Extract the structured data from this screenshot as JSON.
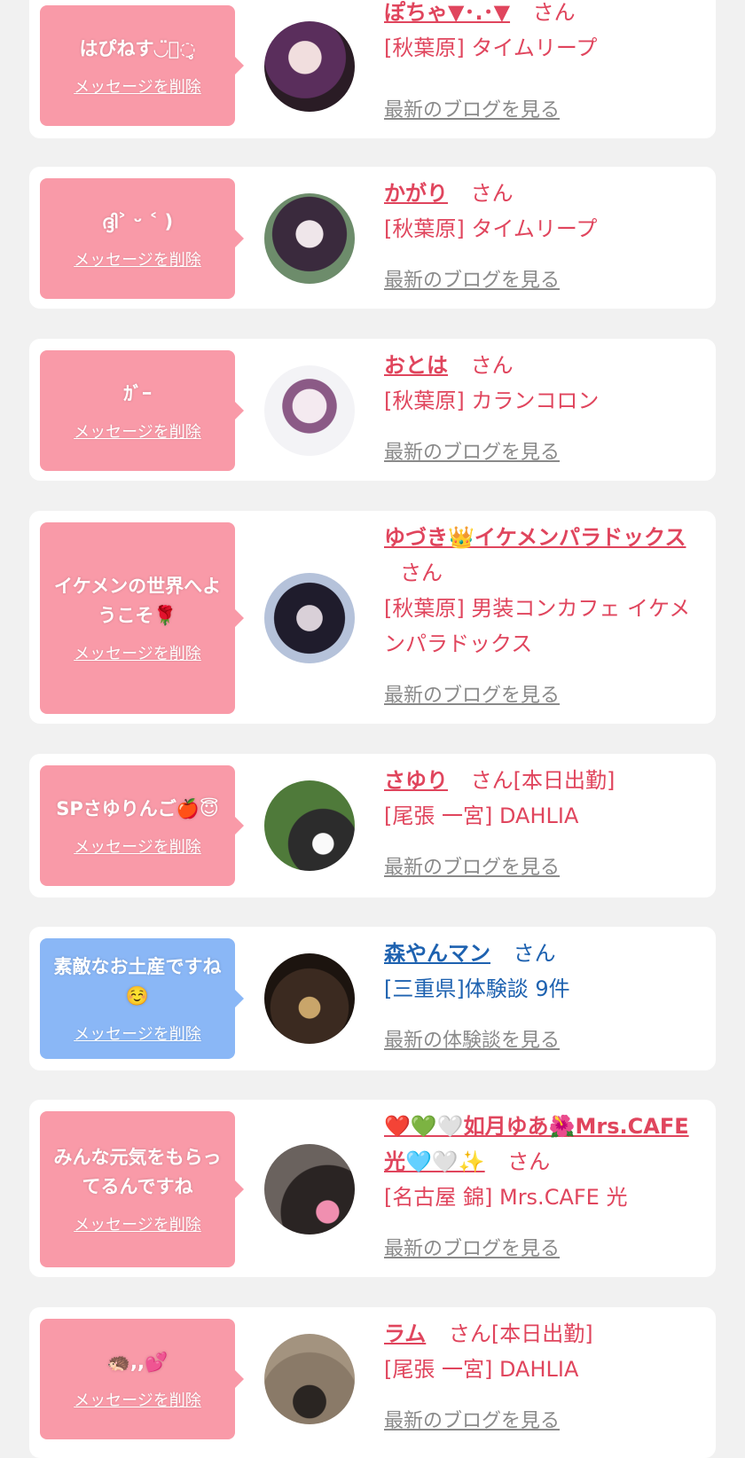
{
  "cards": [
    {
      "message": "はぴねす◡̈⃝︎◌̥",
      "delete_label": "メッセージを削除",
      "name": "ぽちゃ▼･.･▼",
      "san": "さん",
      "shop": "[秋葉原] タイムリープ",
      "blog": "最新のブログを見る",
      "accent": "#e0455d",
      "bubble_color": "#f99aa8"
    },
    {
      "message": "ദ്ദി˃ ᵕ ˂ )",
      "delete_label": "メッセージを削除",
      "name": "かがり",
      "san": "さん",
      "shop": "[秋葉原] タイムリープ",
      "blog": "最新のブログを見る"
    },
    {
      "message": "ｶﾞｰ",
      "delete_label": "メッセージを削除",
      "name": "おとは",
      "san": "さん",
      "shop": "[秋葉原] カランコロン",
      "blog": "最新のブログを見る"
    },
    {
      "message": "イケメンの世界へようこそ🌹",
      "delete_label": "メッセージを削除",
      "name": "ゆづき👑イケメンパラドックス",
      "san": "さん",
      "shop": "[秋葉原] 男装コンカフェ イケメンパラドックス",
      "blog": "最新のブログを見る"
    },
    {
      "message": "SPさゆりんご🍎😇",
      "delete_label": "メッセージを削除",
      "name": "さゆり",
      "san": "さん[本日出勤]",
      "shop": "[尾張 一宮] DAHLIA",
      "blog": "最新のブログを見る"
    },
    {
      "message": "素敵なお土産ですね☺️",
      "delete_label": "メッセージを削除",
      "name": "森やんマン",
      "san": "さん",
      "shop": "[三重県]体験談 9件",
      "blog": "最新の体験談を見る",
      "accent": "#1e62b0",
      "bubble_color": "#8ab7f6"
    },
    {
      "message": "みんな元気をもらってるんですね",
      "delete_label": "メッセージを削除",
      "name": "❤️💚🤍如月ゆあ🌺Mrs.CAFE光🩵🤍✨",
      "san": "さん",
      "shop": "[名古屋 錦] Mrs.CAFE 光",
      "blog": "最新のブログを見る"
    },
    {
      "message": "🦔,,💕",
      "delete_label": "メッセージを削除",
      "name": "ラム",
      "san": "さん[本日出勤]",
      "shop": "[尾張 一宮] DAHLIA",
      "blog": "最新のブログを見る"
    }
  ]
}
